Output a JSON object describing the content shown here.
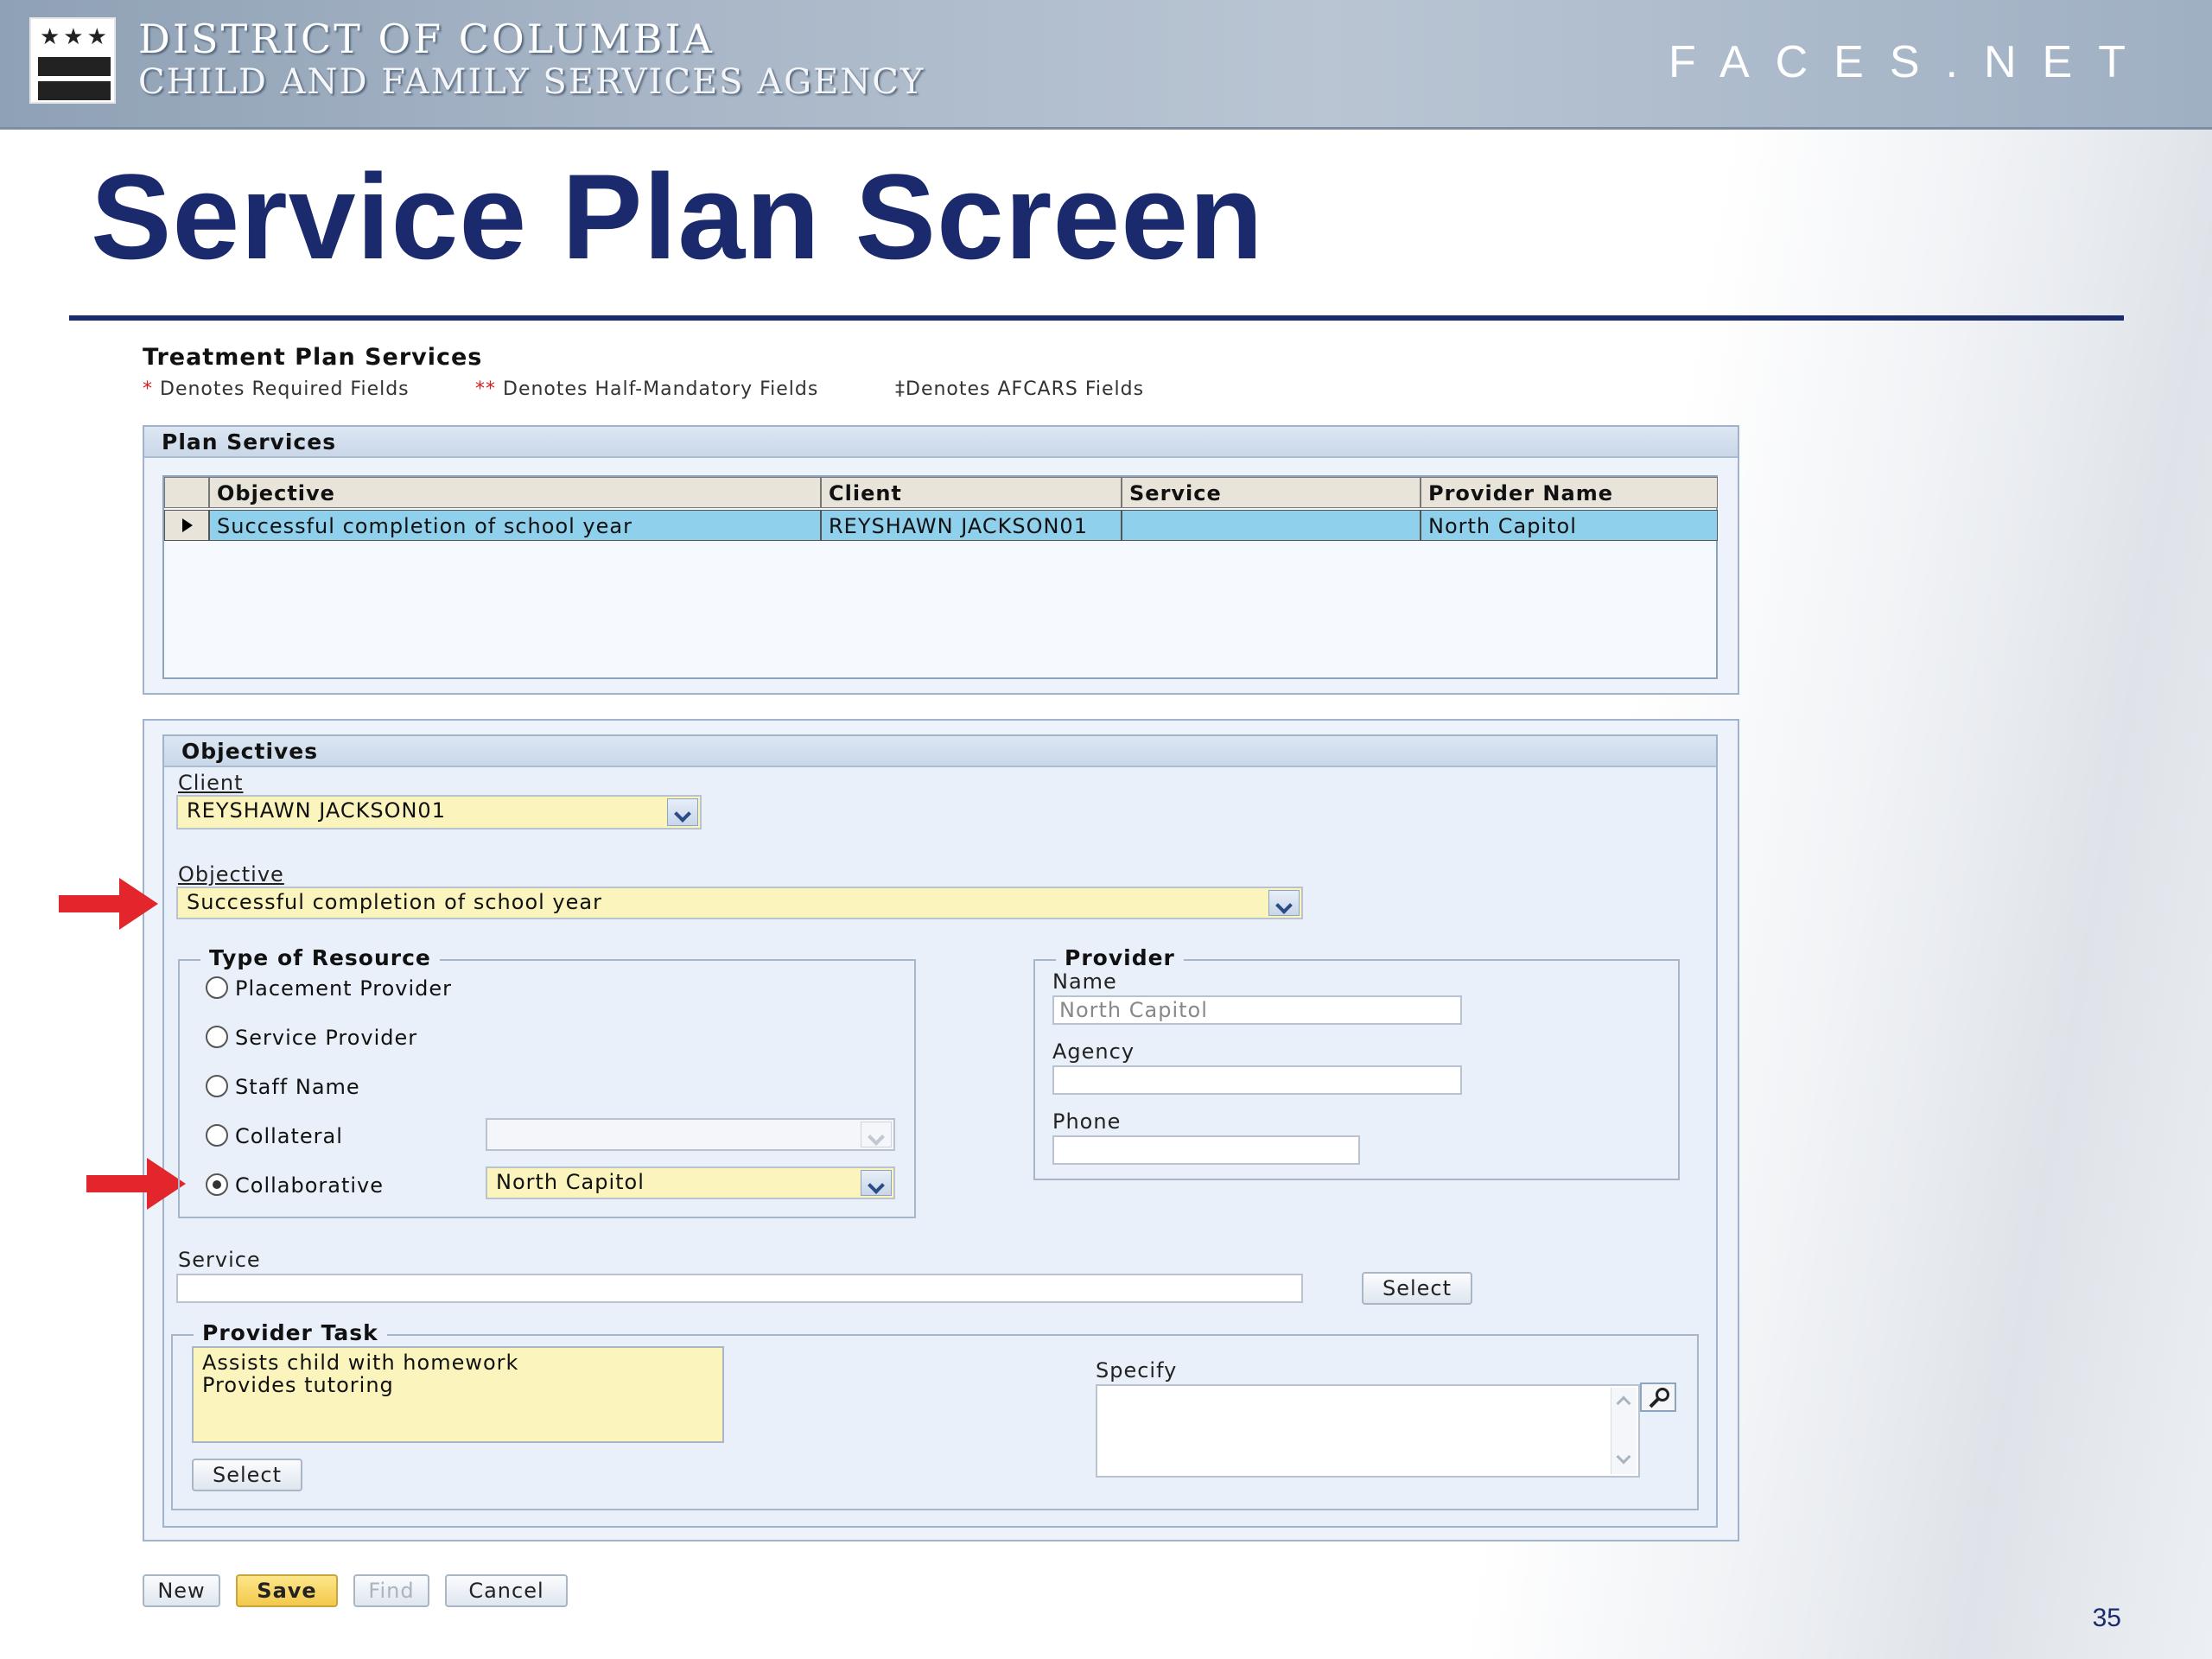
{
  "banner": {
    "agency_name_line1": "DISTRICT OF COLUMBIA",
    "agency_name_line2": "CHILD AND FAMILY SERVICES AGENCY",
    "flag_stars": "★★★",
    "brand": "FACES.NET"
  },
  "slide": {
    "title": "Service Plan Screen",
    "page_number": "35"
  },
  "form": {
    "heading": "Treatment Plan Services",
    "legend": {
      "required_symbol": "*",
      "required_text": "Denotes Required Fields",
      "half_mandatory_symbol": "**",
      "half_mandatory_text": "Denotes Half-Mandatory Fields",
      "afcars_text": "‡Denotes AFCARS Fields"
    },
    "plan_services": {
      "header": "Plan Services",
      "columns": [
        "Objective",
        "Client",
        "Service",
        "Provider Name"
      ],
      "rows": [
        {
          "objective": "Successful completion of school year",
          "client": "REYSHAWN JACKSON01",
          "service": "",
          "provider_name": "North Capitol"
        }
      ]
    },
    "objectives": {
      "header": "Objectives",
      "client_label": "Client",
      "client_value": "REYSHAWN JACKSON01",
      "objective_label": "Objective",
      "objective_value": "Successful completion of school year",
      "type_of_resource": {
        "legend": "Type of Resource",
        "options": [
          "Placement Provider",
          "Service Provider",
          "Staff Name",
          "Collateral",
          "Collaborative"
        ],
        "selected": "Collaborative",
        "collateral_value": "",
        "collaborative_value": "North Capitol"
      },
      "provider": {
        "legend": "Provider",
        "name_label": "Name",
        "name_value": "North Capitol",
        "agency_label": "Agency",
        "agency_value": "",
        "phone_label": "Phone",
        "phone_value": ""
      },
      "service_label": "Service",
      "service_value": "",
      "service_select_label": "Select",
      "provider_task": {
        "legend": "Provider Task",
        "tasks": [
          "Assists child with homework",
          "Provides tutoring"
        ],
        "select_label": "Select",
        "specify_label": "Specify",
        "specify_value": ""
      }
    },
    "buttons": {
      "new": "New",
      "save": "Save",
      "find": "Find",
      "cancel": "Cancel"
    }
  },
  "colors": {
    "title_navy": "#1a2a6c",
    "selected_row": "#8fd0ec",
    "required_field": "#fbf5bd",
    "arrow_red": "#e3262b"
  }
}
